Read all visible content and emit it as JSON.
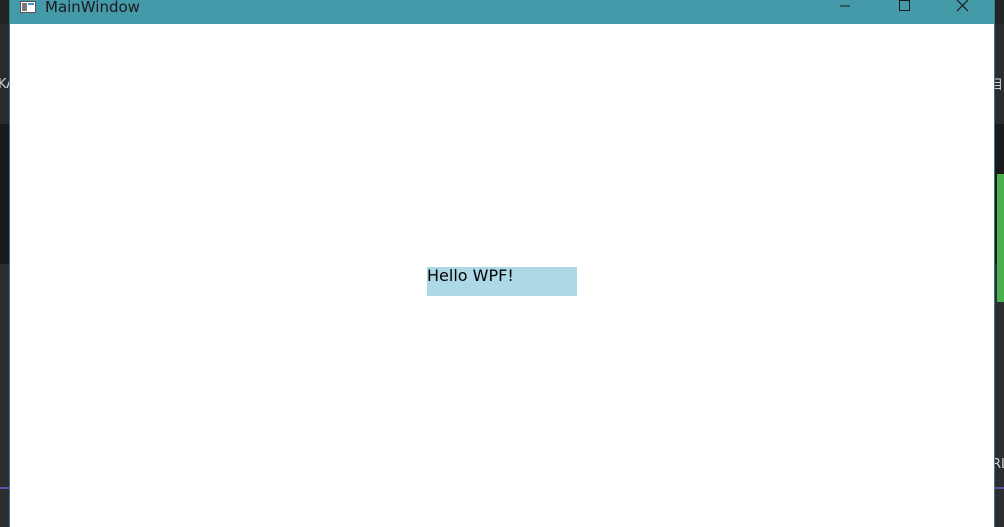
{
  "window": {
    "title": "MainWindow",
    "titlebar_color": "#459aa9",
    "client_background": "#ffffff",
    "icon": "app-window-icon",
    "controls": {
      "minimize_icon": "minimize-icon",
      "maximize_icon": "maximize-icon",
      "close_icon": "close-icon"
    }
  },
  "content": {
    "text_block": {
      "text": "Hello WPF!",
      "background": "#add8e6"
    }
  },
  "background": {
    "glyphs": [
      "KA",
      "目",
      "RL"
    ]
  }
}
